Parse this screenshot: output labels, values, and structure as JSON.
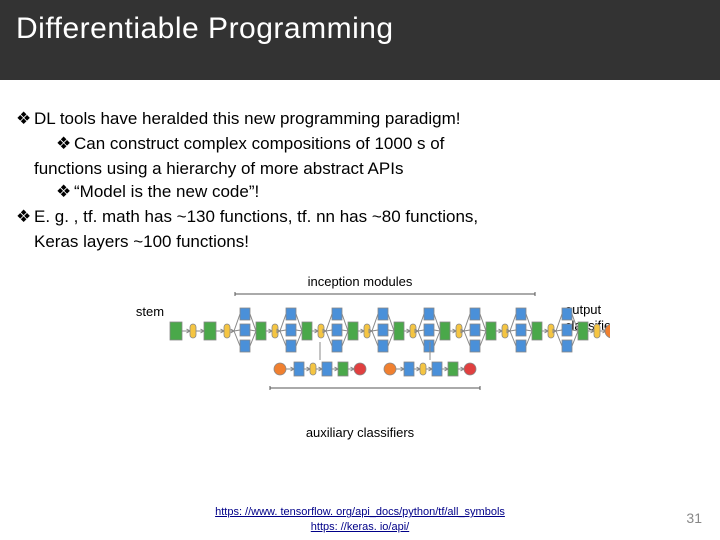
{
  "header": {
    "title": "Differentiable Programming"
  },
  "body": {
    "p1": "DL tools have heralded this new programming paradigm!",
    "p1a": "Can construct complex compositions of 1000 s of",
    "p1a_cont": "functions using a hierarchy of more abstract APIs",
    "p1b": "“Model is the new code”!",
    "p2": "E. g. , tf. math has ~130 functions, tf. nn has ~80 functions,",
    "p2_cont": "Keras layers ~100 functions!"
  },
  "diagram": {
    "top_label": "inception modules",
    "left_label": "stem",
    "right_label_l1": "output",
    "right_label_l2": "classifier",
    "bottom_label": "auxiliary classifiers",
    "colors": {
      "green": "#4aa84a",
      "blue": "#4a90d9",
      "yellow": "#f5c542",
      "orange": "#f08030",
      "red": "#e04040",
      "border": "#888888",
      "bracket": "#555555"
    }
  },
  "links": {
    "l1": "https: //www. tensorflow. org/api_docs/python/tf/all_symbols",
    "l1_href": "https://www.tensorflow.org/api_docs/python/tf/all_symbols",
    "l2": "https: //keras. io/api/",
    "l2_href": "https://keras.io/api/"
  },
  "page": {
    "number": "31"
  }
}
